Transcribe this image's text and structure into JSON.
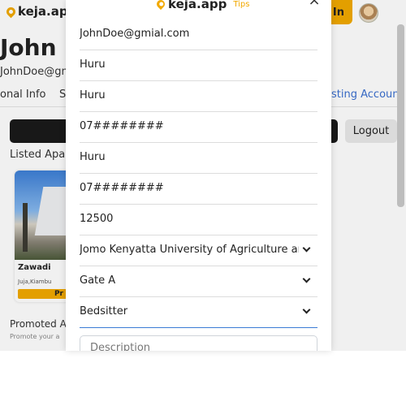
{
  "background": {
    "logo_text": "keja.ap",
    "login_label": "In",
    "profile_name": "John D",
    "profile_email": "JohnDoe@gm",
    "tab_left_label": "onal Info",
    "tab_s_label": "S",
    "tab_right_label": "sting Account",
    "logout_label": "Logout",
    "listed_heading": "Listed Apart",
    "card": {
      "title": "Zawadi",
      "location": "Juja,Kiambu",
      "button_label": "Pr"
    },
    "promoted_heading": "Promoted A",
    "promote_subtext": "Promote your a"
  },
  "modal": {
    "logo_text": "keja.app",
    "tips_label": "Tips",
    "close_label": "×",
    "fields": {
      "email": "JohnDoe@gmial.com",
      "field2": "Huru",
      "field3": "Huru",
      "phone1": "07########",
      "field5": "Huru",
      "phone2": "07########",
      "price": "12500",
      "university": "Jomo Kenyatta University of Agriculture and Technology",
      "gate": "Gate A",
      "house_type": "Bedsitter"
    },
    "description_placeholder": "Description"
  },
  "colors": {
    "brand_accent": "#f2a900",
    "link_blue": "#3a6fd0",
    "focus_blue": "#3a7bd5",
    "dark_button": "#1a1a1a"
  }
}
